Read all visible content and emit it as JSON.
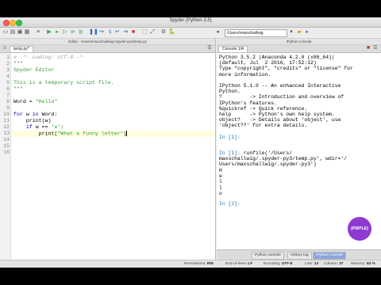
{
  "window": {
    "title": "Spyder (Python 3.5)"
  },
  "toolbar": {
    "path": "/Users/maxschallwig"
  },
  "editor": {
    "header": "Editor - /Users/maxschallwig/.spyder-py3/temp.py",
    "tab": "temp.py*",
    "line_numbers": [
      "1",
      "2",
      "3",
      "4",
      "5",
      "6",
      "7",
      "8",
      "9",
      "10",
      "11",
      "12",
      "13",
      "14",
      "15",
      "16"
    ]
  },
  "code": {
    "l1": "# -*- coding: utf-8 -*-",
    "l2": "\"\"\"",
    "l3": "Spyder Editor",
    "l5": "This is a temporary script file.",
    "l6": "\"\"\"",
    "l8_a": "Word = ",
    "l8_b": "\"Hello\"",
    "l10_a": "for",
    "l10_b": " w ",
    "l10_c": "in",
    "l10_d": " Word:",
    "l11": "    print(w)",
    "l12_a": "    if",
    "l12_b": " w == ",
    "l12_c": "'e'",
    "l12_d": ":",
    "l13_a": "        print(",
    "l13_b": "\"What a funny letter\"",
    "l13_c": ")"
  },
  "console": {
    "header": "IPython console",
    "tab": "Console 1/A",
    "lines": [
      "Python 3.5.2 |Anaconda 4.2.0 (x86_64)|",
      "(default, Jul  2 2016, 17:52:12)",
      "Type \"copyright\", \"credits\" or \"license\" for",
      "more information.",
      "",
      "IPython 5.1.0 -- An enhanced Interactive",
      "Python.",
      "?         -> Introduction and overview of",
      "IPython's features.",
      "%quickref -> Quick reference.",
      "help      -> Python's own help system.",
      "object?   -> Details about 'object', use",
      "'object??' for extra details."
    ],
    "prompt1": "In [1]: ",
    "run_cmd_1": "runfile('/Users/",
    "run_cmd_2": "maxschallwig/.spyder-py3/temp.py', wdir='/",
    "run_cmd_3": "Users/maxschallwig/.spyder-py3')",
    "outputs": [
      "H",
      "e",
      "l",
      "l",
      "o"
    ],
    "prompt2": "In [2]: "
  },
  "bottom_tabs": [
    "Python console",
    "History log",
    "IPython console"
  ],
  "status": {
    "perm_label": "Permissions:",
    "perm_value": "RW",
    "eol_label": "End-of-lines:",
    "eol_value": "LF",
    "enc_label": "Encoding:",
    "enc_value": "UTF-8",
    "line_label": "Line:",
    "line_value": "13",
    "col_label": "Column:",
    "col_value": "37",
    "mem_label": "Memory:",
    "mem_value": "63 %"
  },
  "badge": {
    "text": "{PIRPLE}"
  },
  "colors": {
    "accent": "#8e3ad1",
    "comment": "#9e9e9e",
    "docstring": "#3d9a3d",
    "keyword": "#0000b0",
    "console_prompt": "#1b6fb0"
  },
  "icons": [
    "new-file-icon",
    "open-icon",
    "save-icon",
    "save-all-icon",
    "run-icon",
    "run-cell-icon",
    "debug-icon",
    "stop-icon",
    "maximize-icon",
    "fullscreen-icon",
    "preferences-icon",
    "python-path-icon",
    "back-icon",
    "forward-icon",
    "folder-icon"
  ]
}
